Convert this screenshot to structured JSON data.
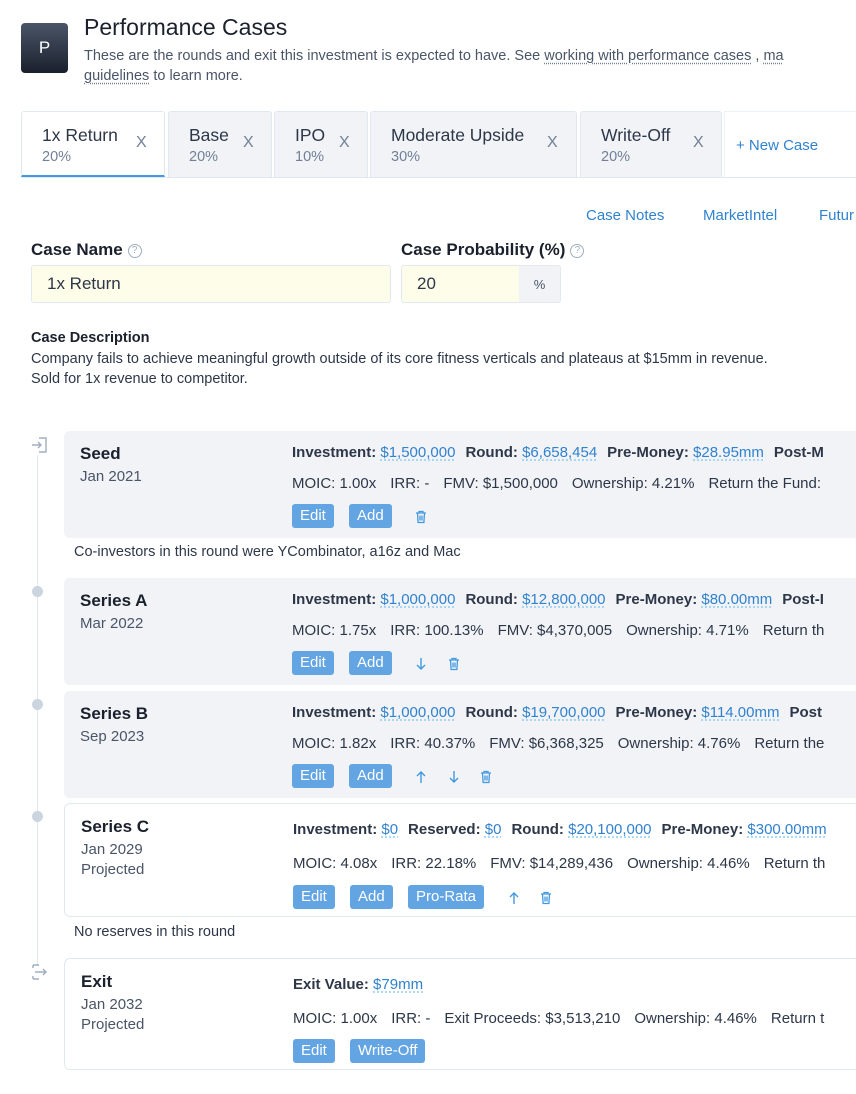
{
  "header": {
    "avatar_letter": "P",
    "title": "Performance Cases",
    "intro_before": "These are the rounds and exit this investment is expected to have. See ",
    "intro_link1": "working with performance cases",
    "intro_sep": " , ",
    "intro_link2": "ma",
    "intro_link3": "guidelines",
    "intro_after": " to learn more."
  },
  "tabs": [
    {
      "name": "1x Return",
      "pct": "20%",
      "close": "X"
    },
    {
      "name": "Base",
      "pct": "20%",
      "close": "X"
    },
    {
      "name": "IPO",
      "pct": "10%",
      "close": "X"
    },
    {
      "name": "Moderate Upside",
      "pct": "30%",
      "close": "X"
    },
    {
      "name": "Write-Off",
      "pct": "20%",
      "close": "X"
    }
  ],
  "new_case": "+ New Case",
  "links": {
    "case_notes": "Case Notes",
    "market_intel": "MarketIntel",
    "future": "Futur"
  },
  "form": {
    "name_label": "Case Name",
    "name_value": "1x Return",
    "prob_label": "Case Probability (%)",
    "prob_value": "20",
    "prob_addon": "%",
    "help_glyph": "?"
  },
  "description": {
    "label": "Case Description",
    "text": "Company fails to achieve meaningful growth outside of its core fitness verticals and plateaus at $15mm in revenue. Sold for 1x revenue to competitor."
  },
  "labels": {
    "investment": "Investment:",
    "round": "Round:",
    "pre_money": "Pre-Money:",
    "reserved": "Reserved:",
    "exit_value": "Exit Value:",
    "edit": "Edit",
    "add": "Add",
    "pro_rata": "Pro-Rata",
    "write_off": "Write-Off"
  },
  "rounds": [
    {
      "name": "Seed",
      "date": "Jan 2021",
      "investment": "$1,500,000",
      "round": "$6,658,454",
      "pre_money": "$28.95mm",
      "post_label": "Post-M",
      "moic": "MOIC: 1.00x",
      "irr": "IRR: -",
      "fmv": "FMV: $1,500,000",
      "ownership": "Ownership: 4.21%",
      "rtf": "Return the Fund:",
      "note": "Co-investors in this round were YCombinator, a16z and Mac"
    },
    {
      "name": "Series A",
      "date": "Mar 2022",
      "investment": "$1,000,000",
      "round": "$12,800,000",
      "pre_money": "$80.00mm",
      "post_label": "Post-I",
      "moic": "MOIC: 1.75x",
      "irr": "IRR: 100.13%",
      "fmv": "FMV: $4,370,005",
      "ownership": "Ownership: 4.71%",
      "rtf": "Return th"
    },
    {
      "name": "Series B",
      "date": "Sep 2023",
      "investment": "$1,000,000",
      "round": "$19,700,000",
      "pre_money": "$114.00mm",
      "post_label": "Post",
      "moic": "MOIC: 1.82x",
      "irr": "IRR: 40.37%",
      "fmv": "FMV: $6,368,325",
      "ownership": "Ownership: 4.76%",
      "rtf": "Return the"
    },
    {
      "name": "Series C",
      "date": "Jan 2029",
      "status": "Projected",
      "investment": "$0",
      "reserved": "$0",
      "round": "$20,100,000",
      "pre_money": "$300.00mm",
      "moic": "MOIC: 4.08x",
      "irr": "IRR: 22.18%",
      "fmv": "FMV: $14,289,436",
      "ownership": "Ownership: 4.46%",
      "rtf": "Return th",
      "note": "No reserves in this round"
    }
  ],
  "exit": {
    "name": "Exit",
    "date": "Jan 2032",
    "status": "Projected",
    "exit_value": "$79mm",
    "moic": "MOIC: 1.00x",
    "irr": "IRR: -",
    "proceeds": "Exit Proceeds: $3,513,210",
    "ownership": "Ownership: 4.46%",
    "rtf": "Return t"
  },
  "colors": {
    "accent": "#3182ce",
    "button": "#63a4e3",
    "card": "#f1f3f7",
    "input": "#fefde9"
  }
}
